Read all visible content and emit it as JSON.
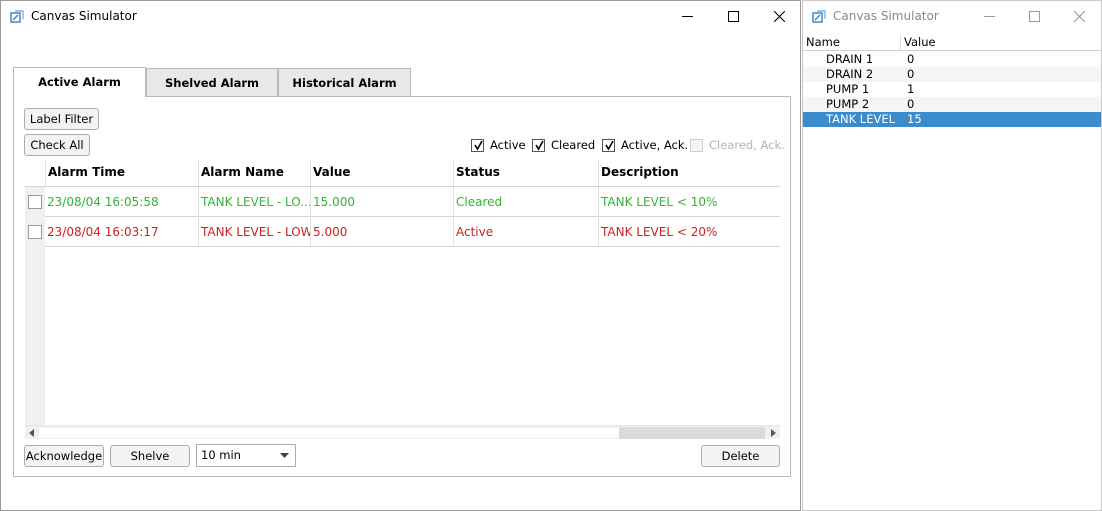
{
  "main_window": {
    "title": "Canvas Simulator",
    "tabs": [
      {
        "label": "Active Alarm",
        "active": true
      },
      {
        "label": "Shelved Alarm",
        "active": false
      },
      {
        "label": "Historical Alarm",
        "active": false
      }
    ],
    "label_filter_button": "Label Filter",
    "check_all_button": "Check All",
    "filters": [
      {
        "label": "Active",
        "checked": true,
        "enabled": true
      },
      {
        "label": "Cleared",
        "checked": true,
        "enabled": true
      },
      {
        "label": "Active, Ack.",
        "checked": true,
        "enabled": true
      },
      {
        "label": "Cleared, Ack.",
        "checked": false,
        "enabled": false
      }
    ],
    "grid": {
      "columns": [
        "Alarm Time",
        "Alarm Name",
        "Value",
        "Status",
        "Description"
      ],
      "rows": [
        {
          "time": "23/08/04 16:05:58",
          "name": "TANK LEVEL - LO...",
          "value": "15.000",
          "status": "Cleared",
          "description": "TANK LEVEL < 10%",
          "color": "#33b533"
        },
        {
          "time": "23/08/04 16:03:17",
          "name": "TANK LEVEL - LOW",
          "value": "5.000",
          "status": "Active",
          "description": "TANK LEVEL < 20%",
          "color": "#cc2222"
        }
      ]
    },
    "acknowledge_button": "Acknowledge",
    "shelve_button": "Shelve",
    "shelve_duration": "10 min",
    "delete_button": "Delete"
  },
  "tag_window": {
    "title": "Canvas Simulator",
    "columns": [
      "Name",
      "Value"
    ],
    "rows": [
      {
        "name": "DRAIN 1",
        "value": "0",
        "selected": false
      },
      {
        "name": "DRAIN 2",
        "value": "0",
        "selected": false
      },
      {
        "name": "PUMP 1",
        "value": "1",
        "selected": false
      },
      {
        "name": "PUMP 2",
        "value": "0",
        "selected": false
      },
      {
        "name": "TANK LEVEL",
        "value": "15",
        "selected": true
      }
    ]
  },
  "icons": [
    "app-icon",
    "minimize-icon",
    "maximize-icon",
    "close-icon",
    "checkmark-icon",
    "dropdown-arrow-icon",
    "scroll-left-icon",
    "scroll-right-icon"
  ]
}
